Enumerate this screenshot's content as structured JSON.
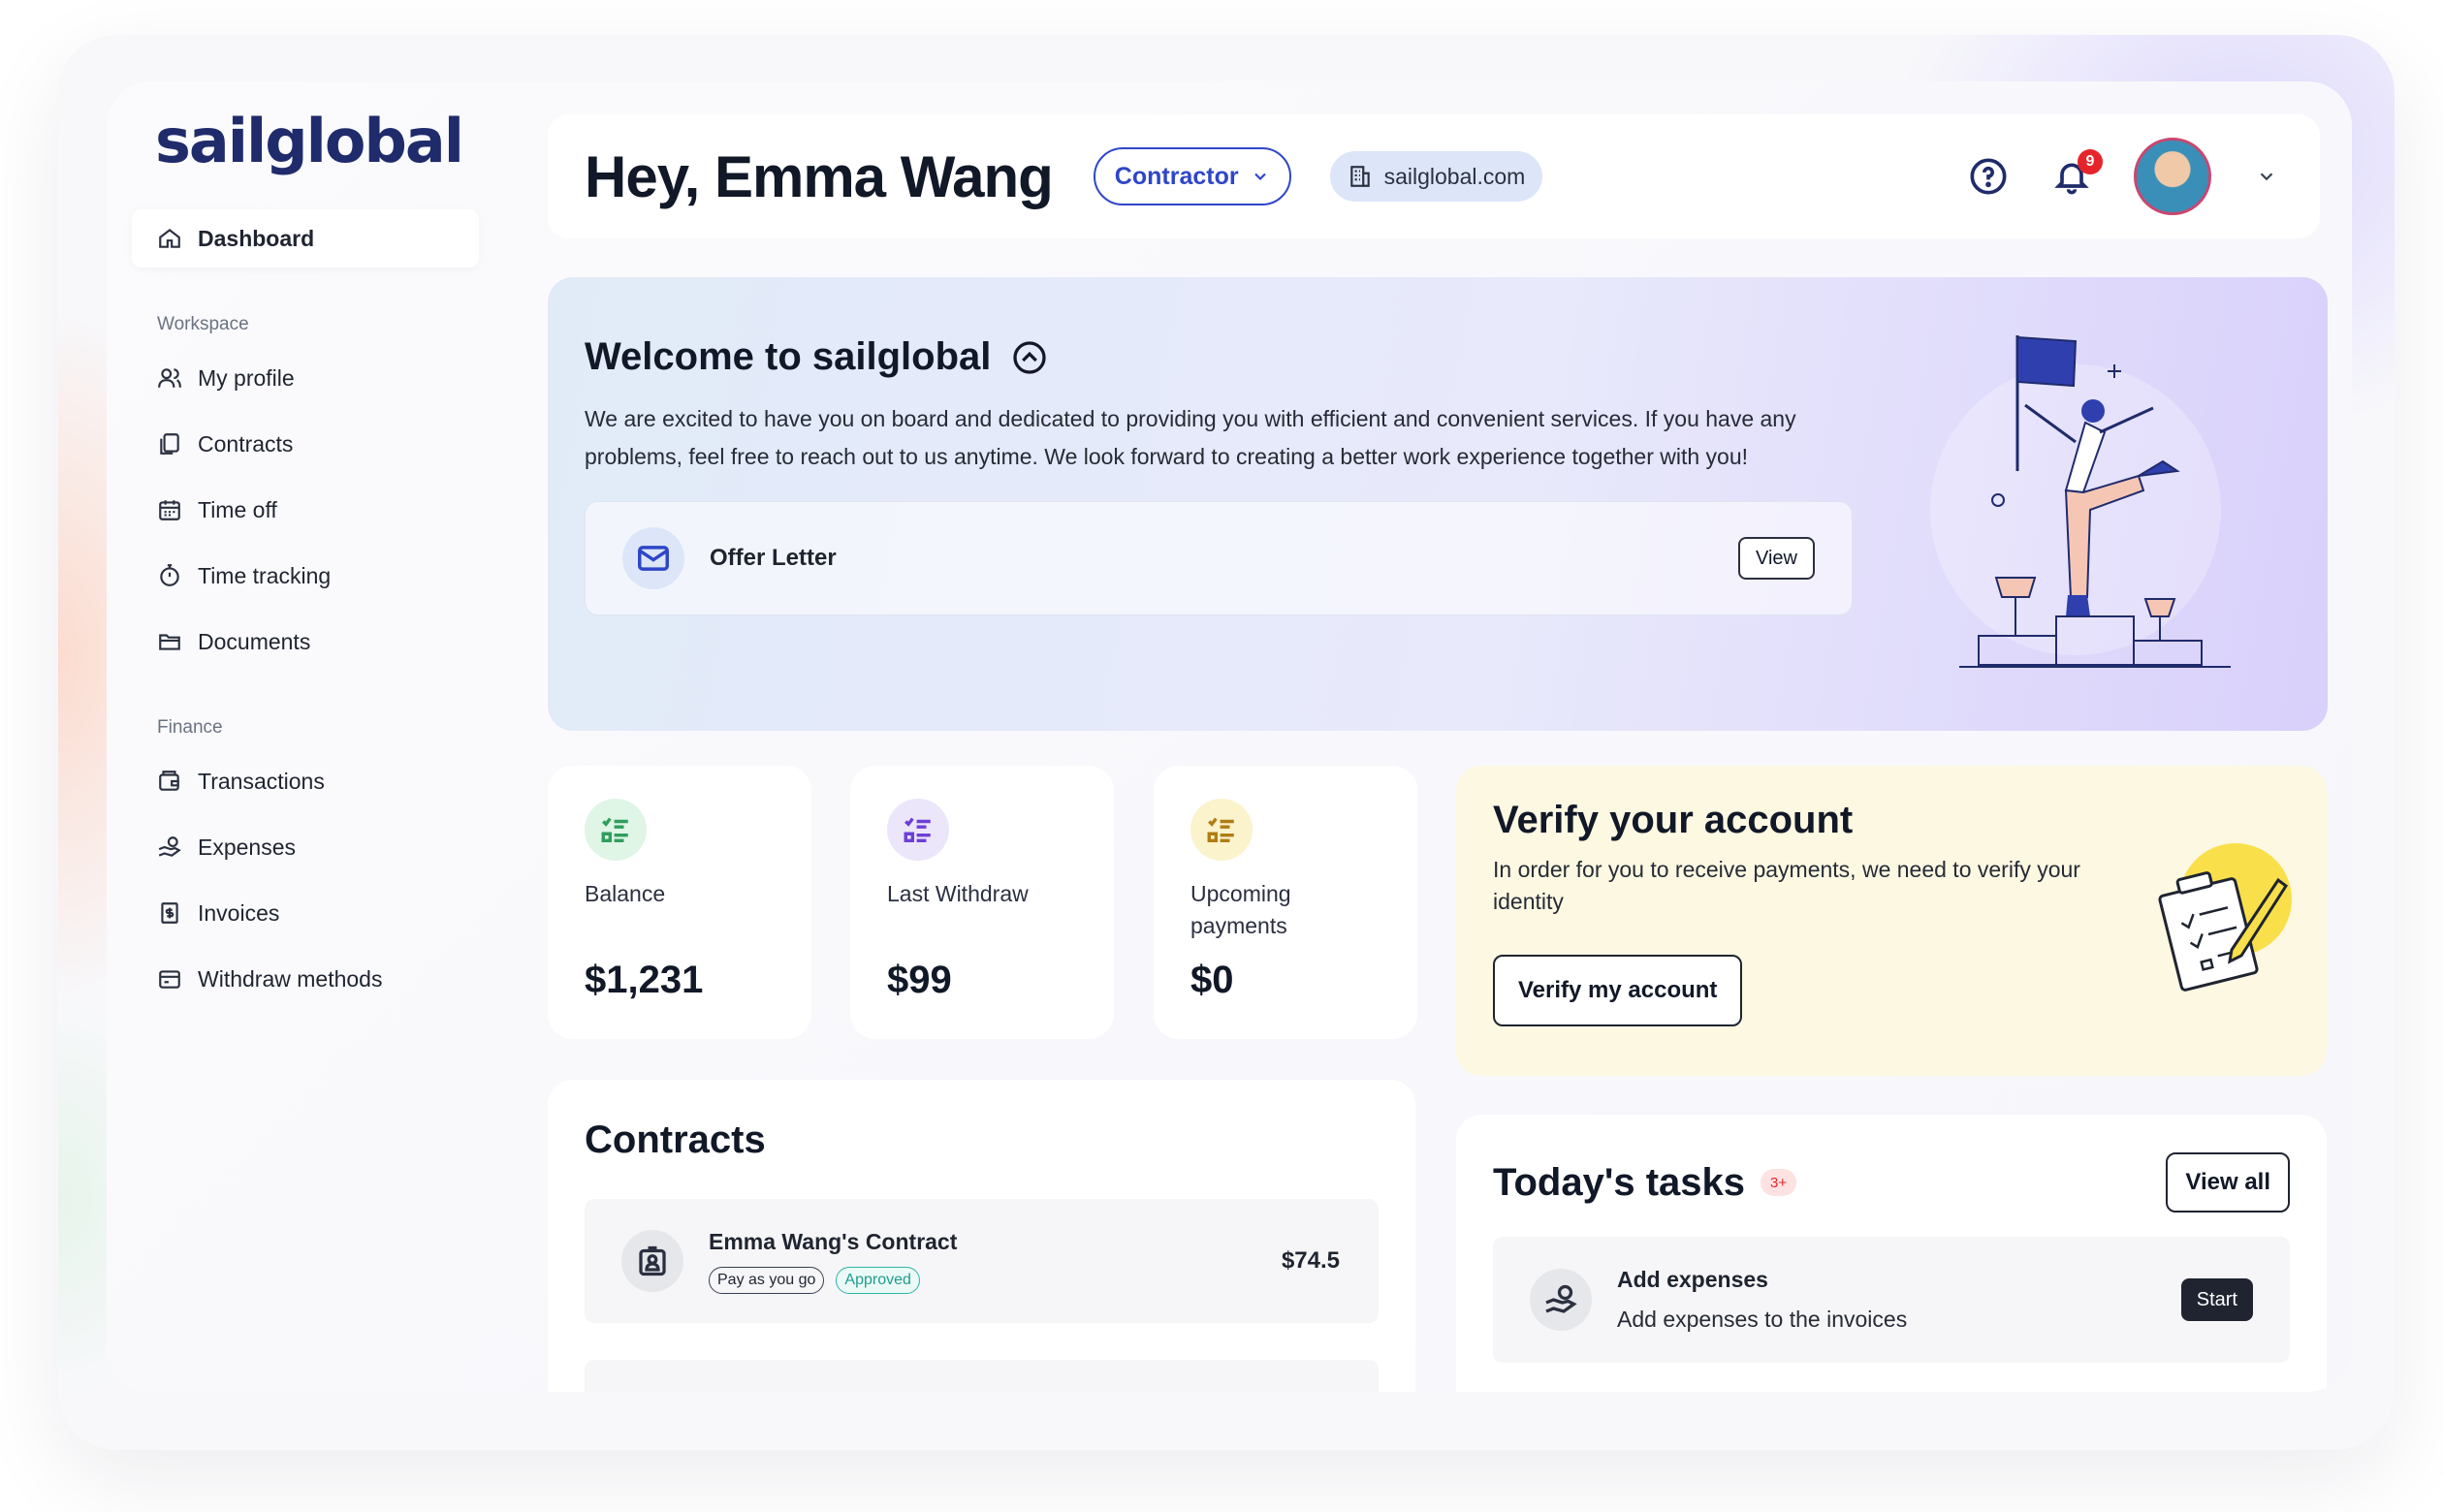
{
  "brand": {
    "logo_text": "sailglobal",
    "logo_color": "#1f2b6b",
    "accent": "#2f46c8"
  },
  "sidebar": {
    "active": {
      "label": "Dashboard",
      "icon": "home-icon"
    },
    "sections": [
      {
        "title": "Workspace",
        "items": [
          {
            "label": "My profile",
            "icon": "users-icon"
          },
          {
            "label": "Contracts",
            "icon": "document-copy-icon"
          },
          {
            "label": "Time off",
            "icon": "calendar-icon"
          },
          {
            "label": "Time tracking",
            "icon": "stopwatch-icon"
          },
          {
            "label": "Documents",
            "icon": "folder-icon"
          }
        ]
      },
      {
        "title": "Finance",
        "items": [
          {
            "label": "Transactions",
            "icon": "wallet-icon"
          },
          {
            "label": "Expenses",
            "icon": "hand-coins-icon"
          },
          {
            "label": "Invoices",
            "icon": "invoice-icon"
          },
          {
            "label": "Withdraw methods",
            "icon": "card-icon"
          }
        ]
      }
    ]
  },
  "header": {
    "greeting": "Hey, Emma Wang",
    "role": "Contractor",
    "domain": "sailglobal.com",
    "notifications_count": "9"
  },
  "welcome": {
    "title": "Welcome to sailglobal",
    "text": "We are excited to have you on board and dedicated to providing you with efficient and convenient services. If you have any problems, feel free to reach out to us anytime. We look forward to creating a better work experience together with you!",
    "offer_label": "Offer Letter",
    "view_label": "View"
  },
  "stats": [
    {
      "label": "Balance",
      "value": "$1,231",
      "icon_color": "#2f9e5c",
      "icon_bg": "#dff5e6"
    },
    {
      "label": "Last Withdraw",
      "value": "$99",
      "icon_color": "#6d3fd6",
      "icon_bg": "#ece6fb"
    },
    {
      "label": "Upcoming payments",
      "value": "$0",
      "icon_color": "#b07d12",
      "icon_bg": "#fbf3cc"
    }
  ],
  "verify": {
    "title": "Verify your account",
    "text": "In order for you to receive payments, we need to verify your identity",
    "button": "Verify my account"
  },
  "contracts": {
    "title": "Contracts",
    "items": [
      {
        "name": "Emma Wang's Contract",
        "tags": [
          "Pay as you go",
          "Approved"
        ],
        "amount": "$74.5"
      }
    ]
  },
  "tasks": {
    "title": "Today's tasks",
    "badge": "3+",
    "view_all": "View all",
    "items": [
      {
        "title": "Add expenses",
        "description": "Add expenses to the invoices",
        "action": "Start"
      }
    ]
  }
}
